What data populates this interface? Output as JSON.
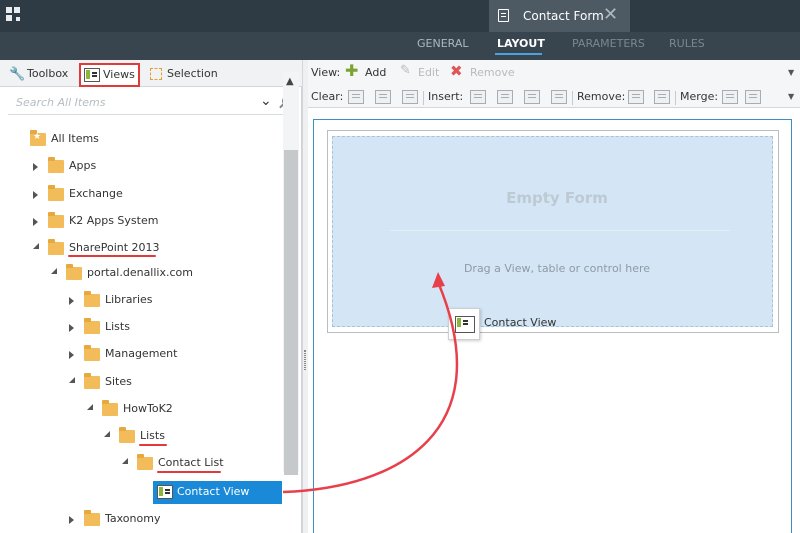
{
  "header": {
    "document_tab": "Contact Form",
    "tabs": [
      {
        "label": "GENERAL"
      },
      {
        "label": "LAYOUT"
      },
      {
        "label": "PARAMETERS"
      },
      {
        "label": "RULES"
      }
    ],
    "active_tab": "LAYOUT"
  },
  "left_panel": {
    "tabs": [
      {
        "label": "Toolbox"
      },
      {
        "label": "Views"
      },
      {
        "label": "Selection"
      }
    ],
    "active_tab": "Views",
    "search_placeholder": "Search All Items",
    "tree": [
      {
        "label": "All Items"
      },
      {
        "label": "Apps"
      },
      {
        "label": "Exchange"
      },
      {
        "label": "K2 Apps System"
      },
      {
        "label": "SharePoint 2013"
      },
      {
        "label": "portal.denallix.com"
      },
      {
        "label": "Libraries"
      },
      {
        "label": "Lists"
      },
      {
        "label": "Management"
      },
      {
        "label": "Sites"
      },
      {
        "label": "HowToK2"
      },
      {
        "label": "Lists"
      },
      {
        "label": "Contact List"
      },
      {
        "label": "Contact View"
      },
      {
        "label": "Taxonomy"
      }
    ]
  },
  "toolbar": {
    "view_label": "View:",
    "add": "Add",
    "edit": "Edit",
    "remove": "Remove",
    "clear_label": "Clear:",
    "insert_label": "Insert:",
    "remove_label": "Remove:",
    "merge_label": "Merge:"
  },
  "canvas": {
    "title": "Empty Form",
    "hint": "Drag a View, table or control here",
    "drag_item": "Contact View"
  },
  "colors": {
    "accent": "#1a8ad8",
    "annotation": "#e03a3a",
    "header_bg": "#38444e"
  }
}
